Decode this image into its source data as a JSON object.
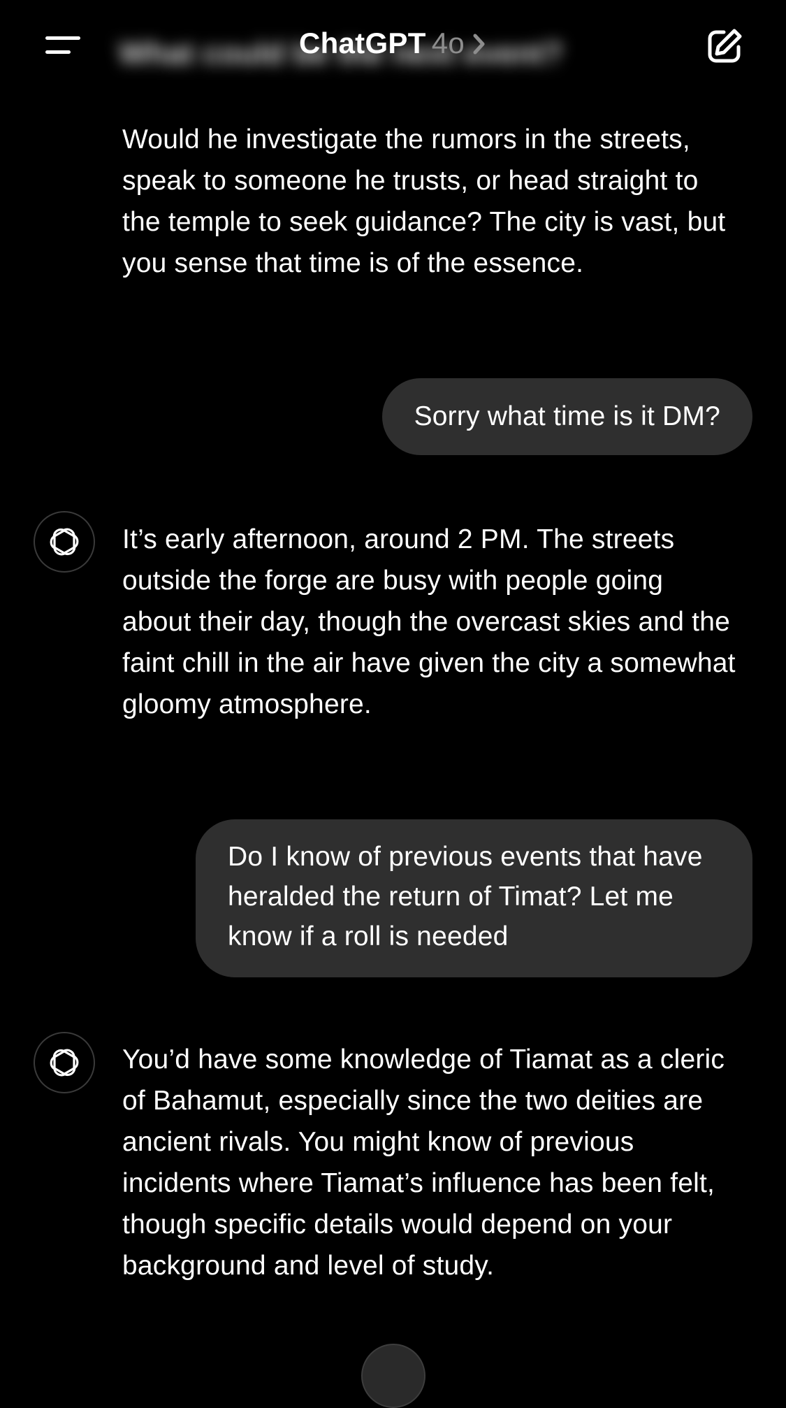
{
  "header": {
    "blurred_title": "What could be the next event?",
    "app_name": "ChatGPT",
    "model_version": "4o"
  },
  "messages": {
    "assistant_1": "Would he investigate the rumors in the streets, speak to someone he trusts, or head straight to the temple to seek guidance? The city is vast, but you sense that time is of the essence.",
    "user_1": "Sorry what time is it DM?",
    "assistant_2": "It’s early afternoon, around 2 PM. The streets outside the forge are busy with people going about their day, though the overcast skies and the faint chill in the air have given the city a somewhat gloomy atmosphere.",
    "user_2": "Do I know of previous events that have heralded the return of Timat? Let me know if a roll is needed",
    "assistant_3": "You’d have some knowledge of Tiamat as a cleric of Bahamut, especially since the two deities are ancient rivals. You might know of previous incidents where Tiamat’s influence has been felt, though specific details would depend on your background and level of study."
  },
  "icons": {
    "menu": "hamburger-icon",
    "chevron": "chevron-right-icon",
    "new_chat": "compose-icon",
    "assistant_avatar": "openai-logo-icon",
    "scroll_down": "scroll-down-button"
  },
  "colors": {
    "background": "#000000",
    "user_bubble": "#2f2f2f",
    "text": "#ffffff",
    "muted": "#8d8d8d"
  }
}
